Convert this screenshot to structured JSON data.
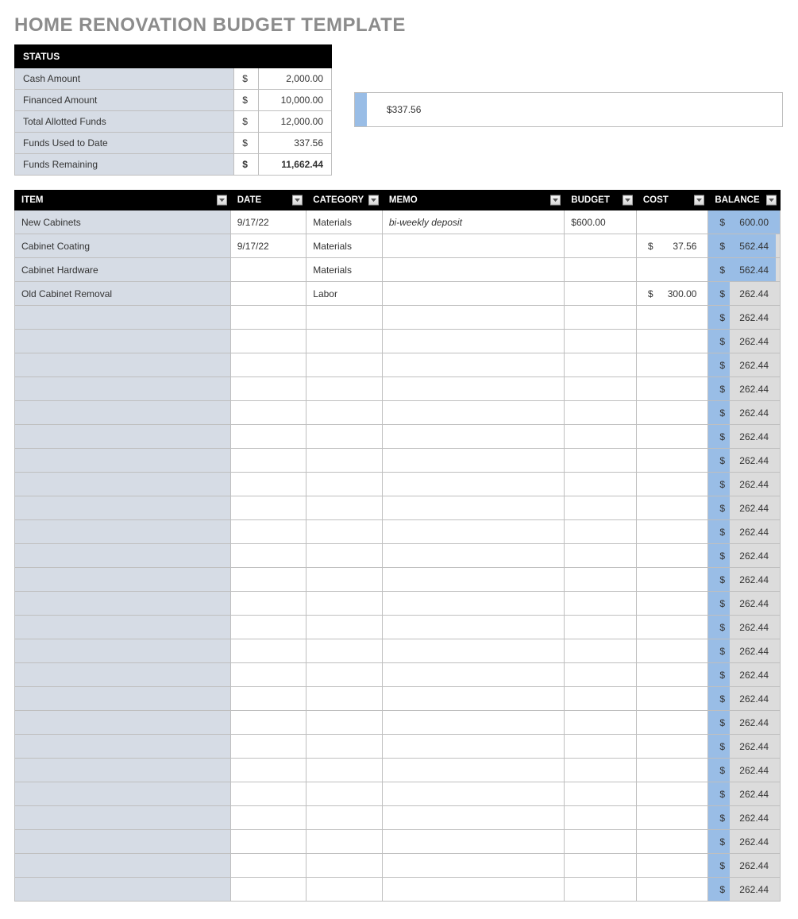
{
  "title": "HOME RENOVATION BUDGET TEMPLATE",
  "status": {
    "header": "STATUS",
    "rows": [
      {
        "label": "Cash Amount",
        "currency": "$",
        "value": "2,000.00",
        "bold": false
      },
      {
        "label": "Financed Amount",
        "currency": "$",
        "value": "10,000.00",
        "bold": false
      },
      {
        "label": "Total Allotted Funds",
        "currency": "$",
        "value": "12,000.00",
        "bold": false
      },
      {
        "label": "Funds Used to Date",
        "currency": "$",
        "value": "337.56",
        "bold": false
      },
      {
        "label": "Funds Remaining",
        "currency": "$",
        "value": "11,662.44",
        "bold": true
      }
    ]
  },
  "progress": {
    "label": "$337.56",
    "fraction": 0.028
  },
  "ledger": {
    "columns": [
      "ITEM",
      "DATE",
      "CATEGORY",
      "MEMO",
      "BUDGET",
      "COST",
      "BALANCE"
    ],
    "rows": [
      {
        "item": "New Cabinets",
        "date": "9/17/22",
        "category": "Materials",
        "memo": "bi-weekly deposit",
        "budget": "$600.00",
        "cost_cur": "",
        "cost": "",
        "bal_cur": "$",
        "balance": "600.00",
        "bal_frac": 1.0
      },
      {
        "item": "Cabinet Coating",
        "date": "9/17/22",
        "category": "Materials",
        "memo": "",
        "budget": "",
        "cost_cur": "$",
        "cost": "37.56",
        "bal_cur": "$",
        "balance": "562.44",
        "bal_frac": 0.94
      },
      {
        "item": "Cabinet Hardware",
        "date": "",
        "category": "Materials",
        "memo": "",
        "budget": "",
        "cost_cur": "",
        "cost": "",
        "bal_cur": "$",
        "balance": "562.44",
        "bal_frac": 0.94
      },
      {
        "item": "Old Cabinet Removal",
        "date": "",
        "category": "Labor",
        "memo": "",
        "budget": "",
        "cost_cur": "$",
        "cost": "300.00",
        "bal_cur": "$",
        "balance": "262.44",
        "bal_frac": 0.3
      },
      {
        "item": "",
        "date": "",
        "category": "",
        "memo": "",
        "budget": "",
        "cost_cur": "",
        "cost": "",
        "bal_cur": "$",
        "balance": "262.44",
        "bal_frac": 0.3
      },
      {
        "item": "",
        "date": "",
        "category": "",
        "memo": "",
        "budget": "",
        "cost_cur": "",
        "cost": "",
        "bal_cur": "$",
        "balance": "262.44",
        "bal_frac": 0.3
      },
      {
        "item": "",
        "date": "",
        "category": "",
        "memo": "",
        "budget": "",
        "cost_cur": "",
        "cost": "",
        "bal_cur": "$",
        "balance": "262.44",
        "bal_frac": 0.3
      },
      {
        "item": "",
        "date": "",
        "category": "",
        "memo": "",
        "budget": "",
        "cost_cur": "",
        "cost": "",
        "bal_cur": "$",
        "balance": "262.44",
        "bal_frac": 0.3
      },
      {
        "item": "",
        "date": "",
        "category": "",
        "memo": "",
        "budget": "",
        "cost_cur": "",
        "cost": "",
        "bal_cur": "$",
        "balance": "262.44",
        "bal_frac": 0.3
      },
      {
        "item": "",
        "date": "",
        "category": "",
        "memo": "",
        "budget": "",
        "cost_cur": "",
        "cost": "",
        "bal_cur": "$",
        "balance": "262.44",
        "bal_frac": 0.3
      },
      {
        "item": "",
        "date": "",
        "category": "",
        "memo": "",
        "budget": "",
        "cost_cur": "",
        "cost": "",
        "bal_cur": "$",
        "balance": "262.44",
        "bal_frac": 0.3
      },
      {
        "item": "",
        "date": "",
        "category": "",
        "memo": "",
        "budget": "",
        "cost_cur": "",
        "cost": "",
        "bal_cur": "$",
        "balance": "262.44",
        "bal_frac": 0.3
      },
      {
        "item": "",
        "date": "",
        "category": "",
        "memo": "",
        "budget": "",
        "cost_cur": "",
        "cost": "",
        "bal_cur": "$",
        "balance": "262.44",
        "bal_frac": 0.3
      },
      {
        "item": "",
        "date": "",
        "category": "",
        "memo": "",
        "budget": "",
        "cost_cur": "",
        "cost": "",
        "bal_cur": "$",
        "balance": "262.44",
        "bal_frac": 0.3
      },
      {
        "item": "",
        "date": "",
        "category": "",
        "memo": "",
        "budget": "",
        "cost_cur": "",
        "cost": "",
        "bal_cur": "$",
        "balance": "262.44",
        "bal_frac": 0.3
      },
      {
        "item": "",
        "date": "",
        "category": "",
        "memo": "",
        "budget": "",
        "cost_cur": "",
        "cost": "",
        "bal_cur": "$",
        "balance": "262.44",
        "bal_frac": 0.3
      },
      {
        "item": "",
        "date": "",
        "category": "",
        "memo": "",
        "budget": "",
        "cost_cur": "",
        "cost": "",
        "bal_cur": "$",
        "balance": "262.44",
        "bal_frac": 0.3
      },
      {
        "item": "",
        "date": "",
        "category": "",
        "memo": "",
        "budget": "",
        "cost_cur": "",
        "cost": "",
        "bal_cur": "$",
        "balance": "262.44",
        "bal_frac": 0.3
      },
      {
        "item": "",
        "date": "",
        "category": "",
        "memo": "",
        "budget": "",
        "cost_cur": "",
        "cost": "",
        "bal_cur": "$",
        "balance": "262.44",
        "bal_frac": 0.3
      },
      {
        "item": "",
        "date": "",
        "category": "",
        "memo": "",
        "budget": "",
        "cost_cur": "",
        "cost": "",
        "bal_cur": "$",
        "balance": "262.44",
        "bal_frac": 0.3
      },
      {
        "item": "",
        "date": "",
        "category": "",
        "memo": "",
        "budget": "",
        "cost_cur": "",
        "cost": "",
        "bal_cur": "$",
        "balance": "262.44",
        "bal_frac": 0.3
      },
      {
        "item": "",
        "date": "",
        "category": "",
        "memo": "",
        "budget": "",
        "cost_cur": "",
        "cost": "",
        "bal_cur": "$",
        "balance": "262.44",
        "bal_frac": 0.3
      },
      {
        "item": "",
        "date": "",
        "category": "",
        "memo": "",
        "budget": "",
        "cost_cur": "",
        "cost": "",
        "bal_cur": "$",
        "balance": "262.44",
        "bal_frac": 0.3
      },
      {
        "item": "",
        "date": "",
        "category": "",
        "memo": "",
        "budget": "",
        "cost_cur": "",
        "cost": "",
        "bal_cur": "$",
        "balance": "262.44",
        "bal_frac": 0.3
      },
      {
        "item": "",
        "date": "",
        "category": "",
        "memo": "",
        "budget": "",
        "cost_cur": "",
        "cost": "",
        "bal_cur": "$",
        "balance": "262.44",
        "bal_frac": 0.3
      },
      {
        "item": "",
        "date": "",
        "category": "",
        "memo": "",
        "budget": "",
        "cost_cur": "",
        "cost": "",
        "bal_cur": "$",
        "balance": "262.44",
        "bal_frac": 0.3
      },
      {
        "item": "",
        "date": "",
        "category": "",
        "memo": "",
        "budget": "",
        "cost_cur": "",
        "cost": "",
        "bal_cur": "$",
        "balance": "262.44",
        "bal_frac": 0.3
      },
      {
        "item": "",
        "date": "",
        "category": "",
        "memo": "",
        "budget": "",
        "cost_cur": "",
        "cost": "",
        "bal_cur": "$",
        "balance": "262.44",
        "bal_frac": 0.3
      },
      {
        "item": "",
        "date": "",
        "category": "",
        "memo": "",
        "budget": "",
        "cost_cur": "",
        "cost": "",
        "bal_cur": "$",
        "balance": "262.44",
        "bal_frac": 0.3
      }
    ]
  },
  "chart_data": {
    "type": "bar",
    "title": "Funds Used to Date",
    "categories": [
      "Funds Used"
    ],
    "values": [
      337.56
    ],
    "xlim": [
      0,
      12000
    ],
    "xlabel": "",
    "ylabel": ""
  }
}
